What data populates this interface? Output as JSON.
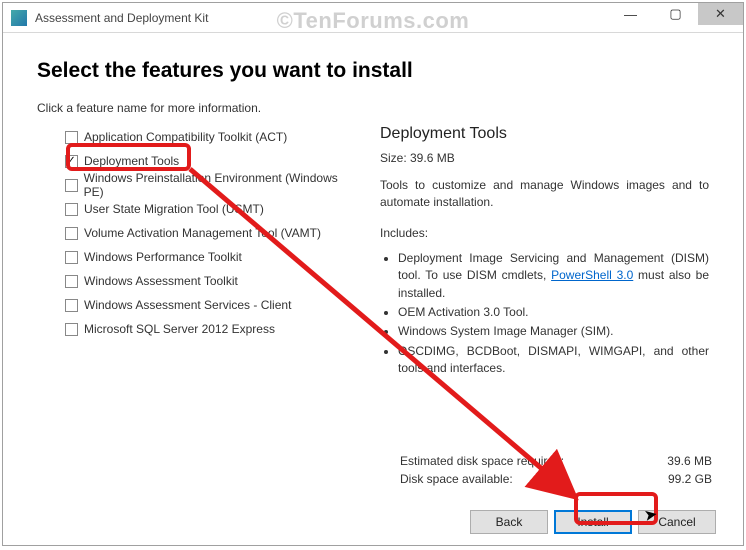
{
  "window": {
    "title": "Assessment and Deployment Kit"
  },
  "watermark": "©TenForums.com",
  "heading": "Select the features you want to install",
  "subtext": "Click a feature name for more information.",
  "features": [
    {
      "label": "Application Compatibility Toolkit (ACT)",
      "checked": false
    },
    {
      "label": "Deployment Tools",
      "checked": true
    },
    {
      "label": "Windows Preinstallation Environment (Windows PE)",
      "checked": false
    },
    {
      "label": "User State Migration Tool (USMT)",
      "checked": false
    },
    {
      "label": "Volume Activation Management Tool (VAMT)",
      "checked": false
    },
    {
      "label": "Windows Performance Toolkit",
      "checked": false
    },
    {
      "label": "Windows Assessment Toolkit",
      "checked": false
    },
    {
      "label": "Windows Assessment Services - Client",
      "checked": false
    },
    {
      "label": "Microsoft SQL Server 2012 Express",
      "checked": false
    }
  ],
  "detail": {
    "title": "Deployment Tools",
    "size": "Size: 39.6 MB",
    "desc": "Tools to customize and manage Windows images and to automate installation.",
    "includes_label": "Includes:",
    "bullets": {
      "b1a": "Deployment Image Servicing and Management (DISM) tool. To use DISM cmdlets, ",
      "b1link": "PowerShell 3.0",
      "b1b": " must also be installed.",
      "b2": "OEM Activation 3.0 Tool.",
      "b3": "Windows System Image Manager (SIM).",
      "b4": "OSCDIMG, BCDBoot, DISMAPI, WIMGAPI, and other tools and interfaces."
    }
  },
  "estimates": {
    "required_label": "Estimated disk space required:",
    "required_value": "39.6 MB",
    "available_label": "Disk space available:",
    "available_value": "99.2 GB"
  },
  "buttons": {
    "back": "Back",
    "install": "Install",
    "cancel": "Cancel"
  }
}
